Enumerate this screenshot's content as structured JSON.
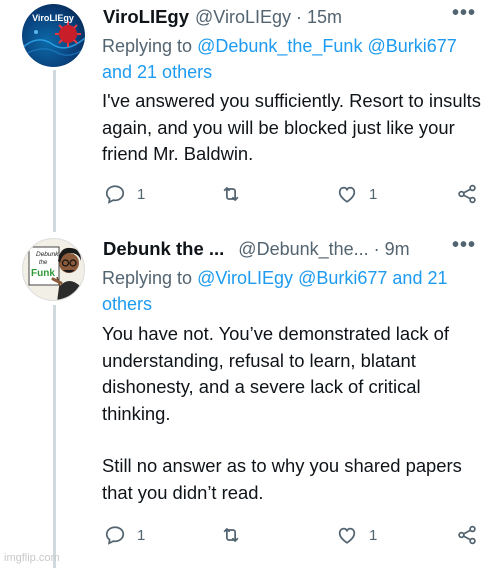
{
  "tweets": [
    {
      "display_name": "ViroLIEgy",
      "handle": "@ViroLIEgy",
      "separator": "·",
      "time": "15m",
      "more": "•••",
      "avatar_text": "ViroLIEgy",
      "reply": {
        "prefix": "Replying to ",
        "mentions": [
          "@Debunk_the_Funk",
          "@Burki677"
        ],
        "others": "and 21 others"
      },
      "paragraphs": [
        "I've answered you sufficiently. Resort to insults again, and you will be blocked just like your friend Mr. Baldwin."
      ],
      "actions": {
        "reply_count": "1",
        "retweet_count": "",
        "like_count": "1"
      }
    },
    {
      "display_name": "Debunk the ...",
      "handle": "@Debunk_the...",
      "separator": "·",
      "time": "9m",
      "more": "•••",
      "avatar_text": [
        "Debunk",
        "the",
        "Funk"
      ],
      "reply": {
        "prefix": "Replying to ",
        "mentions": [
          "@ViroLIEgy",
          "@Burki677"
        ],
        "others": "and 21 others"
      },
      "paragraphs": [
        "You have not. You’ve demonstrated lack of understanding, refusal to learn, blatant dishonesty, and a severe lack of critical thinking.",
        "Still no answer as to why you shared papers that you didn’t read."
      ],
      "actions": {
        "reply_count": "1",
        "retweet_count": "",
        "like_count": "1"
      }
    }
  ],
  "watermark": "imgflip.com",
  "icons": [
    "reply-icon",
    "retweet-icon",
    "like-icon",
    "share-icon"
  ],
  "colors": {
    "text": "#0f1419",
    "secondary": "#536471",
    "link": "#1d9bf0",
    "thread_line": "#cfd9de"
  }
}
